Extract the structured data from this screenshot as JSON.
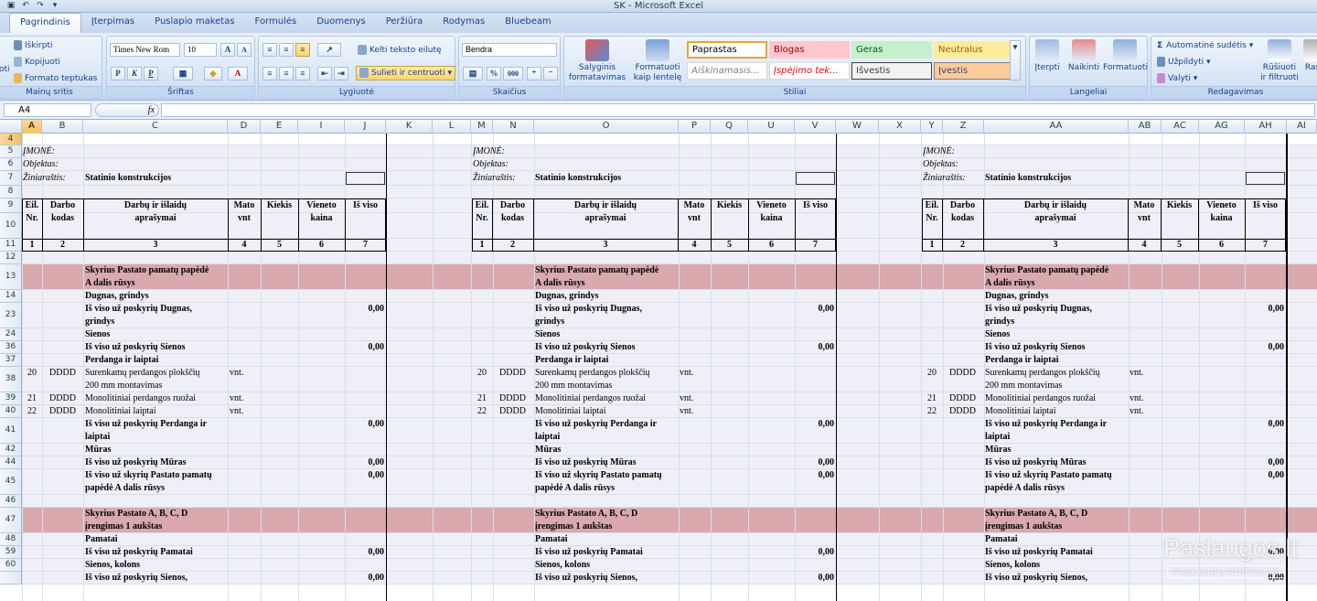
{
  "window": {
    "title": "SK - Microsoft Excel"
  },
  "qat": [
    "save-icon",
    "undo-icon",
    "redo-icon",
    "customize-icon"
  ],
  "tabs": [
    "Pagrindinis",
    "Įterpimas",
    "Puslapio maketas",
    "Formulės",
    "Duomenys",
    "Peržiūra",
    "Rodymas",
    "Bluebeam"
  ],
  "ribbon": {
    "clipboard": {
      "cut": "Iškirpti",
      "copy": "Kopijuoti",
      "painter": "Formato teptukas",
      "label": "Mainų sritis",
      "paste": "oti"
    },
    "font": {
      "name": "Times New Rom",
      "size": "10",
      "grow": "A",
      "shrink": "A",
      "bold": "P",
      "italic": "K",
      "underline": "P",
      "fontcolor": "A",
      "label": "Šriftas"
    },
    "alignment": {
      "wrap": "Kelti teksto eilutę",
      "merge": "Sulieti ir centruoti",
      "label": "Lygiuotė"
    },
    "number": {
      "format": "Bendra",
      "percent": "%",
      "thousands": "000",
      "label": "Skaičius"
    },
    "styles": {
      "conditional": "Salyginis formatavimas",
      "astable": "Formatuoti kaip lentelę",
      "label": "Stiliai",
      "cells": [
        {
          "text": "Paprastas",
          "bg": "#ffffff",
          "fg": "#000000",
          "border": "#e8a33c"
        },
        {
          "text": "Blogas",
          "bg": "#ffc7ce",
          "fg": "#9c0006",
          "border": "#ffc7ce"
        },
        {
          "text": "Geras",
          "bg": "#c6efce",
          "fg": "#006100",
          "border": "#c6efce"
        },
        {
          "text": "Neutralus",
          "bg": "#ffeb9c",
          "fg": "#9c6500",
          "border": "#ffeb9c"
        },
        {
          "text": "Aiškinamasis...",
          "bg": "#ffffff",
          "fg": "#7f7f7f",
          "border": "#d9d9d9"
        },
        {
          "text": "Įspėjimo tek...",
          "bg": "#ffffff",
          "fg": "#ff0000",
          "border": "#d9d9d9"
        },
        {
          "text": "Išvestis",
          "bg": "#f2f2f2",
          "fg": "#3f3f3f",
          "border": "#3f3f3f"
        },
        {
          "text": "Įvestis",
          "bg": "#ffcc99",
          "fg": "#3f3f76",
          "border": "#7f7f7f"
        }
      ]
    },
    "cells": {
      "insert": "Įterpti",
      "delete": "Naikinti",
      "format": "Formatuoti",
      "label": "Langeliai"
    },
    "editing": {
      "autosum": "Automatinė sudėtis",
      "fill": "Užpildyti",
      "clear": "Valyti",
      "sort": "Rūšiuoti ir filtruoti",
      "find": "Ras",
      "label": "Redagavimas"
    }
  },
  "formula_bar": {
    "name_box": "A4",
    "fx": "fx",
    "content": ""
  },
  "columns": [
    "A",
    "B",
    "C",
    "D",
    "E",
    "I",
    "J",
    "K",
    "L",
    "M",
    "N",
    "O",
    "P",
    "Q",
    "U",
    "V",
    "W",
    "X",
    "Y",
    "Z",
    "AA",
    "AB",
    "AC",
    "AG",
    "AH",
    "AI"
  ],
  "row_numbers": [
    "4",
    "5",
    "6",
    "7",
    "8",
    "9",
    "10",
    "11",
    "12",
    "13",
    "14",
    "23",
    "24",
    "36",
    "37",
    "38",
    "39",
    "40",
    "41",
    "42",
    "44",
    "45",
    "46",
    "47",
    "48",
    "59",
    "60",
    ""
  ],
  "blocks": [
    {
      "imone": "ĮMONĖ:",
      "objektas": "Objektas:",
      "ziniarastis": "Žiniaraštis:",
      "konstrukcijos": "Statinio konstrukcijos",
      "headers": [
        [
          "Eil.",
          "Nr."
        ],
        [
          "Darbo",
          "kodas"
        ],
        [
          "Darbų ir išlaidų",
          "aprašymai"
        ],
        [
          "Mato",
          "vnt"
        ],
        [
          "Kiekis",
          ""
        ],
        [
          "Vieneto",
          "kaina"
        ],
        [
          "Iš viso",
          ""
        ]
      ],
      "numbers": [
        "1",
        "2",
        "3",
        "4",
        "5",
        "6",
        "7"
      ],
      "rows": [
        {
          "c": [
            "Skyrius  Pastato pamatų papėdė",
            "A dalis rūsys"
          ]
        },
        {
          "c": [
            "Dugnas, grindys"
          ]
        },
        {
          "c": [
            "Iš viso už poskyrių  Dugnas,",
            "grindys"
          ],
          "j": "0,00"
        },
        {
          "c": [
            "Sienos"
          ]
        },
        {
          "c": [
            "Iš viso už poskyrių  Sienos"
          ],
          "j": "0,00"
        },
        {
          "c": [
            "Perdanga ir laiptai"
          ]
        },
        {
          "a": "20",
          "b": "DDDD",
          "c": [
            "Surenkamų perdangos plokščių",
            "200 mm montavimas"
          ],
          "d": "vnt."
        },
        {
          "a": "21",
          "b": "DDDD",
          "c": [
            "Monolitiniai perdangos ruožai"
          ],
          "d": "vnt."
        },
        {
          "a": "22",
          "b": "DDDD",
          "c": [
            "Monolitiniai laiptai"
          ],
          "d": "vnt."
        },
        {
          "c": [
            "Iš viso už poskyrių  Perdanga ir",
            "laiptai"
          ],
          "j": "0,00"
        },
        {
          "c": [
            "Mūras"
          ]
        },
        {
          "c": [
            "Iš viso už poskyrių  Mūras"
          ],
          "j": "0,00"
        },
        {
          "c": [
            "Iš viso už skyrių  Pastato pamatų",
            "papėdė A dalis rūsys"
          ],
          "j": "0,00"
        },
        {
          "c": [
            ""
          ]
        },
        {
          "c": [
            "Skyrius   Pastato A, B, C, D",
            "įrengimas 1 aukštas"
          ]
        },
        {
          "c": [
            "Pamatai"
          ]
        },
        {
          "c": [
            "Iš viso už poskyrių  Pamatai"
          ],
          "j": "0,00"
        },
        {
          "c": [
            "Sienos, kolons"
          ]
        },
        {
          "c": [
            "Iš viso už poskyrių  Sienos,"
          ],
          "j": "0,00"
        }
      ]
    }
  ],
  "colors": {
    "section_band": "#d9a9ae",
    "section_band_lavender": "#efeff8",
    "ribbon_bg": "#d3e2f5",
    "selected_header": "#f1c15f"
  },
  "watermark": {
    "logo": "Paslaugos.lt",
    "tagline": "PASLAUGŲ PORTALAS"
  }
}
